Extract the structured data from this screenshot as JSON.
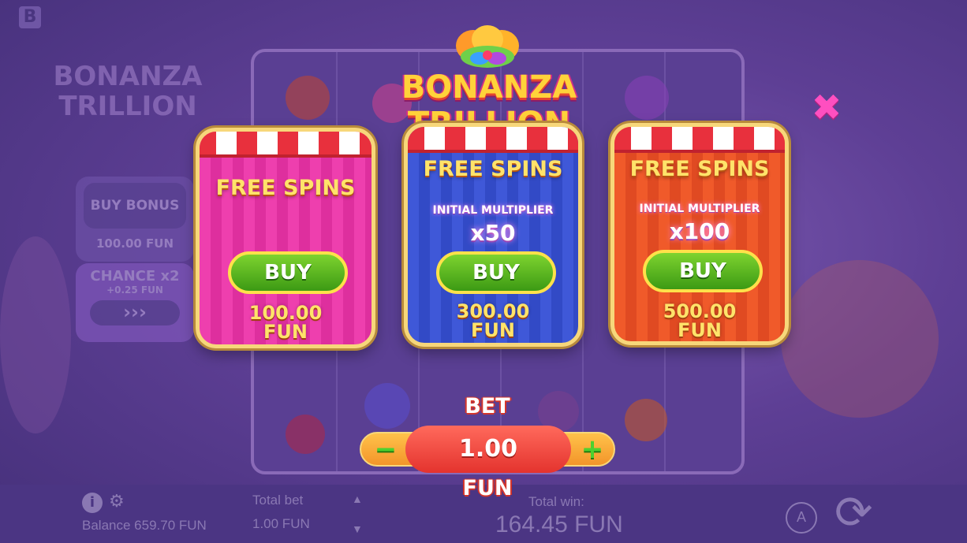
{
  "game": {
    "logo_text": "BONANZA TRILLION",
    "close_symbol": "✖"
  },
  "cards": [
    {
      "title": "FREE SPINS",
      "multiplier_label": "",
      "multiplier": "",
      "buy_label": "BUY",
      "price_amount": "100.00",
      "price_currency": "FUN"
    },
    {
      "title": "FREE SPINS",
      "multiplier_label": "INITIAL MULTIPLIER",
      "multiplier": "x50",
      "buy_label": "BUY",
      "price_amount": "300.00",
      "price_currency": "FUN"
    },
    {
      "title": "FREE SPINS",
      "multiplier_label": "INITIAL MULTIPLIER",
      "multiplier": "x100",
      "buy_label": "BUY",
      "price_amount": "500.00",
      "price_currency": "FUN"
    }
  ],
  "bet": {
    "label": "BET",
    "value": "1.00",
    "unit": "FUN",
    "minus": "−",
    "plus": "+"
  },
  "background": {
    "provider_letter": "B",
    "logo_line1": "BONANZA",
    "logo_line2": "TRILLION",
    "buy_bonus_label": "BUY BONUS",
    "buy_bonus_price": "100.00 FUN",
    "chance_label": "CHANCE x2",
    "chance_cost": "+0.25 FUN",
    "chance_arrows": "›››"
  },
  "status_bar": {
    "info_icon": "i",
    "settings_icon": "⚙",
    "balance": "Balance 659.70 FUN",
    "total_bet_label": "Total bet",
    "total_bet_value": "1.00 FUN",
    "total_win_label": "Total win:",
    "total_win_value": "164.45 FUN",
    "autoplay_symbol": "A",
    "spin_symbol": "⟳",
    "up_arrow": "▲",
    "down_arrow": "▼"
  },
  "colors": {
    "card1": "#ee3fae",
    "card2": "#3f58d8",
    "card3": "#f05a2a",
    "buy_green": "#5cb82a",
    "gold_text": "#ffe36a",
    "close_pink": "#ff4fc0"
  }
}
